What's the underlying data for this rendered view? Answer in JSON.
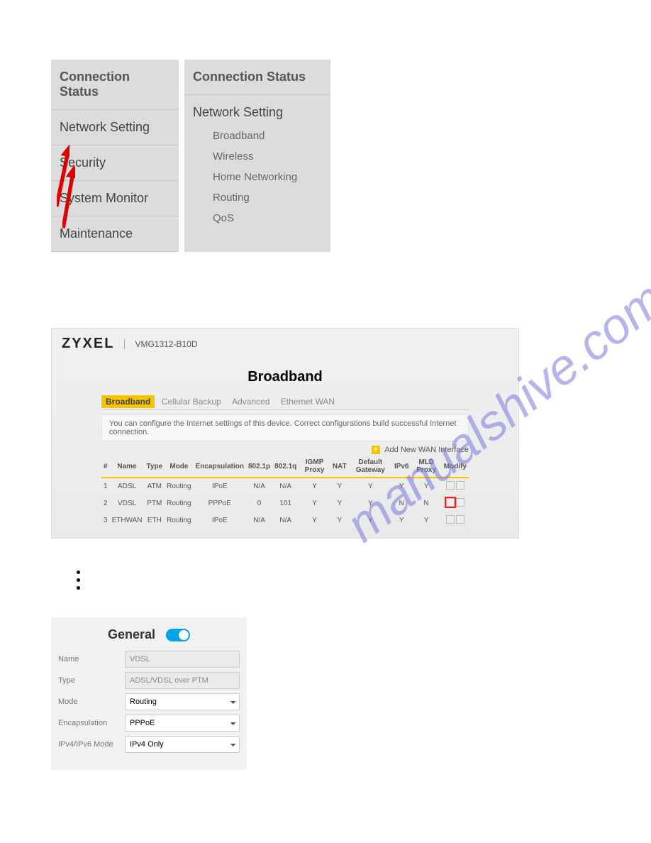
{
  "watermark": "manualshive.com",
  "menu_left": {
    "items": [
      "Connection Status",
      "Network Setting",
      "Security",
      "System Monitor",
      "Maintenance"
    ]
  },
  "menu_right": {
    "header": "Connection Status",
    "section": "Network Setting",
    "subitems": [
      "Broadband",
      "Wireless",
      "Home Networking",
      "Routing",
      "QoS"
    ]
  },
  "broadband": {
    "logo": "ZYXEL",
    "model": "VMG1312-B10D",
    "title": "Broadband",
    "tabs": [
      "Broadband",
      "Cellular Backup",
      "Advanced",
      "Ethernet WAN"
    ],
    "note": "You can configure the Internet settings of this device. Correct configurations build successful Internet connection.",
    "add_label": "Add New WAN Interface",
    "columns": [
      "#",
      "Name",
      "Type",
      "Mode",
      "Encapsulation",
      "802.1p",
      "802.1q",
      "IGMP Proxy",
      "NAT",
      "Default Gateway",
      "IPv6",
      "MLD Proxy",
      "Modify"
    ],
    "rows": [
      {
        "n": "1",
        "name": "ADSL",
        "type": "ATM",
        "mode": "Routing",
        "enc": "IPoE",
        "p": "N/A",
        "q": "N/A",
        "igmp": "Y",
        "nat": "Y",
        "gw": "Y",
        "ipv6": "Y",
        "mld": "Y",
        "hl": false
      },
      {
        "n": "2",
        "name": "VDSL",
        "type": "PTM",
        "mode": "Routing",
        "enc": "PPPoE",
        "p": "0",
        "q": "101",
        "igmp": "Y",
        "nat": "Y",
        "gw": "Y",
        "ipv6": "N",
        "mld": "N",
        "hl": true
      },
      {
        "n": "3",
        "name": "ETHWAN",
        "type": "ETH",
        "mode": "Routing",
        "enc": "IPoE",
        "p": "N/A",
        "q": "N/A",
        "igmp": "Y",
        "nat": "Y",
        "gw": "Y",
        "ipv6": "Y",
        "mld": "Y",
        "hl": false
      }
    ]
  },
  "general": {
    "title": "General",
    "fields": {
      "name_label": "Name",
      "name_value": "VDSL",
      "type_label": "Type",
      "type_value": "ADSL/VDSL over PTM",
      "mode_label": "Mode",
      "mode_value": "Routing",
      "enc_label": "Encapsulation",
      "enc_value": "PPPoE",
      "ipmode_label": "IPv4/IPv6 Mode",
      "ipmode_value": "IPv4 Only"
    }
  }
}
